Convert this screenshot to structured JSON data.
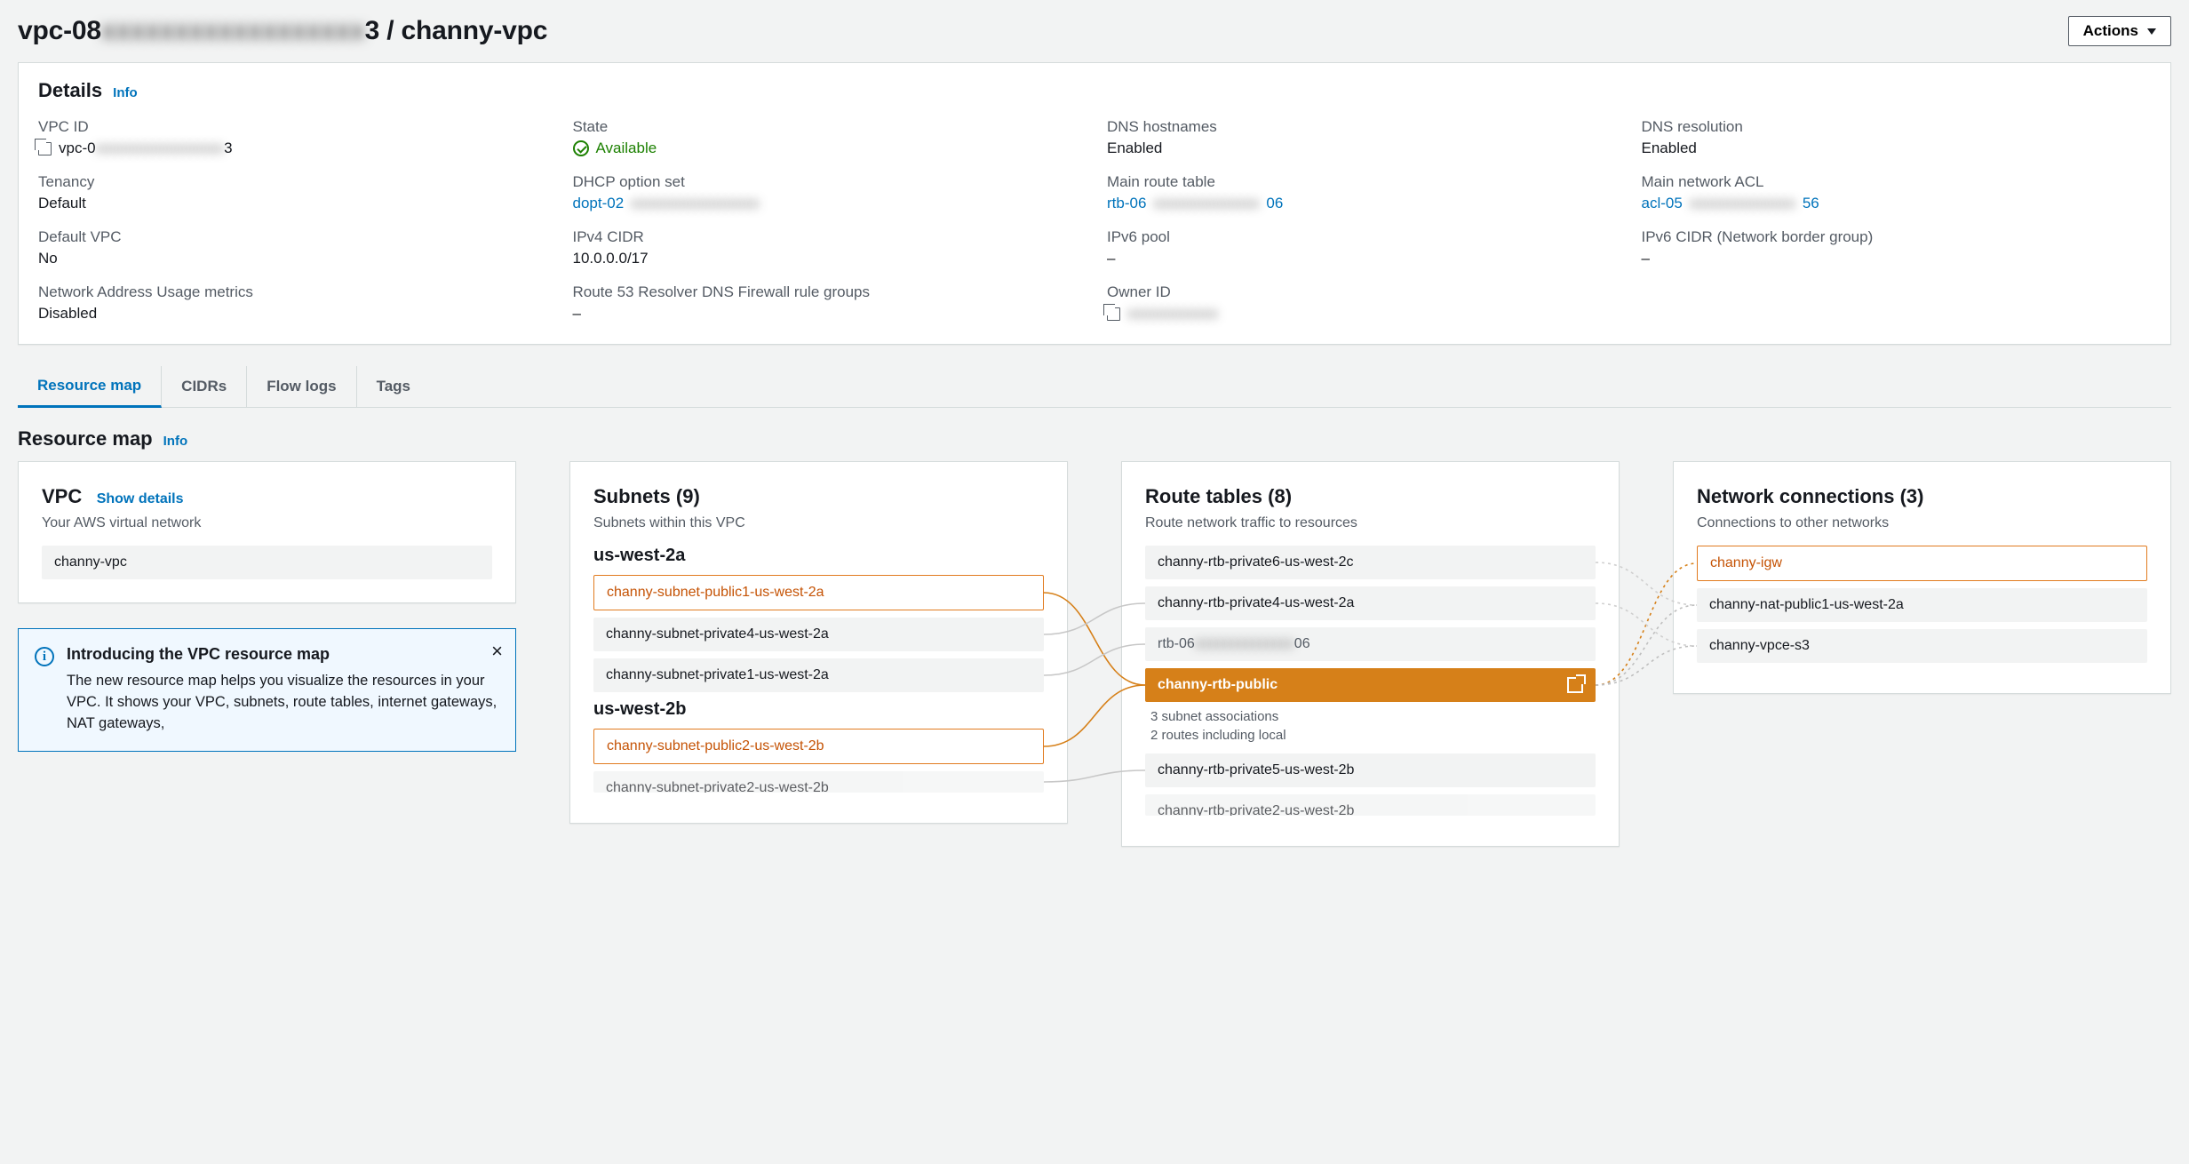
{
  "header": {
    "title_prefix": "vpc-08",
    "title_blur": "xxxxxxxxxxxxxxxxxx",
    "title_suffix": "3 / channy-vpc",
    "actions_label": "Actions"
  },
  "details": {
    "title": "Details",
    "info": "Info",
    "rows": {
      "vpc_id": {
        "label": "VPC ID",
        "prefix": "vpc-0",
        "blur": "xxxxxxxxxxxxxxxxx",
        "suffix": "3"
      },
      "state": {
        "label": "State",
        "value": "Available",
        "color": "green"
      },
      "dns_hostnames": {
        "label": "DNS hostnames",
        "value": "Enabled"
      },
      "dns_resolution": {
        "label": "DNS resolution",
        "value": "Enabled"
      },
      "tenancy": {
        "label": "Tenancy",
        "value": "Default"
      },
      "dhcp": {
        "label": "DHCP option set",
        "prefix": "dopt-02",
        "blur": "xxxxxxxxxxxxxxxxx",
        "suffix": ""
      },
      "main_route_table": {
        "label": "Main route table",
        "prefix": "rtb-06",
        "blur": "xxxxxxxxxxxxxx",
        "suffix": "06"
      },
      "main_nacl": {
        "label": "Main network ACL",
        "prefix": "acl-05",
        "blur": "xxxxxxxxxxxxxx",
        "suffix": "56"
      },
      "default_vpc": {
        "label": "Default VPC",
        "value": "No"
      },
      "ipv4_cidr": {
        "label": "IPv4 CIDR",
        "value": "10.0.0.0/17"
      },
      "ipv6_pool": {
        "label": "IPv6 pool",
        "value": "–"
      },
      "ipv6_cidr": {
        "label": "IPv6 CIDR (Network border group)",
        "value": "–"
      },
      "nau": {
        "label": "Network Address Usage metrics",
        "value": "Disabled"
      },
      "r53": {
        "label": "Route 53 Resolver DNS Firewall rule groups",
        "value": "–"
      },
      "owner": {
        "label": "Owner ID",
        "blur": "xxxxxxxxxxxx"
      }
    }
  },
  "tabs": [
    "Resource map",
    "CIDRs",
    "Flow logs",
    "Tags"
  ],
  "resource_map": {
    "title": "Resource map",
    "info": "Info",
    "vpc_card": {
      "title": "VPC",
      "show_details": "Show details",
      "sub": "Your AWS virtual network",
      "name": "channy-vpc"
    },
    "infobox": {
      "title": "Introducing the VPC resource map",
      "body": "The new resource map helps you visualize the resources in your VPC. It shows your VPC, subnets, route tables, internet gateways, NAT gateways,"
    },
    "subnets": {
      "title": "Subnets (9)",
      "sub": "Subnets within this VPC",
      "zones": [
        {
          "name": "us-west-2a",
          "items": [
            {
              "label": "channy-subnet-public1-us-west-2a",
              "style": "outline-orange"
            },
            {
              "label": "channy-subnet-private4-us-west-2a",
              "style": ""
            },
            {
              "label": "channy-subnet-private1-us-west-2a",
              "style": ""
            }
          ]
        },
        {
          "name": "us-west-2b",
          "items": [
            {
              "label": "channy-subnet-public2-us-west-2b",
              "style": "outline-orange"
            },
            {
              "label": "channy-subnet-private2-us-west-2b",
              "style": "half"
            }
          ]
        }
      ]
    },
    "route_tables": {
      "title": "Route tables (8)",
      "sub": "Route network traffic to resources",
      "items": [
        {
          "label": "channy-rtb-private6-us-west-2c",
          "style": ""
        },
        {
          "label": "channy-rtb-private4-us-west-2a",
          "style": ""
        },
        {
          "label": "rtb-06",
          "blur": "xxxxxxxxxxxxxx",
          "suffix": "06",
          "style": "faded"
        },
        {
          "label": "channy-rtb-public",
          "style": "solid-orange",
          "meta1": "3 subnet associations",
          "meta2": "2 routes including local"
        },
        {
          "label": "channy-rtb-private5-us-west-2b",
          "style": ""
        },
        {
          "label": "channy-rtb-private2-us-west-2b",
          "style": "half"
        }
      ]
    },
    "connections": {
      "title": "Network connections (3)",
      "sub": "Connections to other networks",
      "items": [
        {
          "label": "channy-igw",
          "style": "outline-orange"
        },
        {
          "label": "channy-nat-public1-us-west-2a",
          "style": ""
        },
        {
          "label": "channy-vpce-s3",
          "style": ""
        }
      ]
    }
  }
}
